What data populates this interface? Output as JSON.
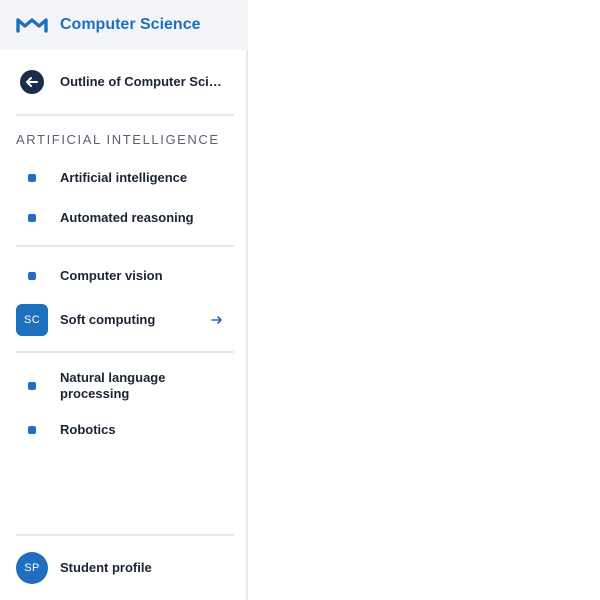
{
  "brand": {
    "logo_icon": "m-logo-icon",
    "title": "Computer Science"
  },
  "back": {
    "icon": "arrow-left-icon",
    "label": "Outline of Computer Science"
  },
  "section": {
    "heading": "ARTIFICIAL INTELLIGENCE"
  },
  "nav": {
    "items": [
      {
        "label": "Artificial intelligence",
        "icon": "bullet-icon"
      },
      {
        "label": "Automated reasoning",
        "icon": "bullet-icon"
      },
      {
        "label": "Computer vision",
        "icon": "bullet-icon"
      },
      {
        "label": "Soft computing",
        "badge": "SC",
        "trailing_icon": "arrow-right-icon"
      },
      {
        "label": "Natural language processing",
        "icon": "bullet-icon"
      },
      {
        "label": "Robotics",
        "icon": "bullet-icon"
      }
    ]
  },
  "profile": {
    "initials": "SP",
    "label": "Student profile"
  },
  "colors": {
    "brand_blue": "#1f6fbf",
    "navy": "#1a2e4a",
    "text_dark": "#1b2433",
    "muted": "#5a6270",
    "divider": "#e6e8ec",
    "header_bg": "#f4f5f8"
  }
}
